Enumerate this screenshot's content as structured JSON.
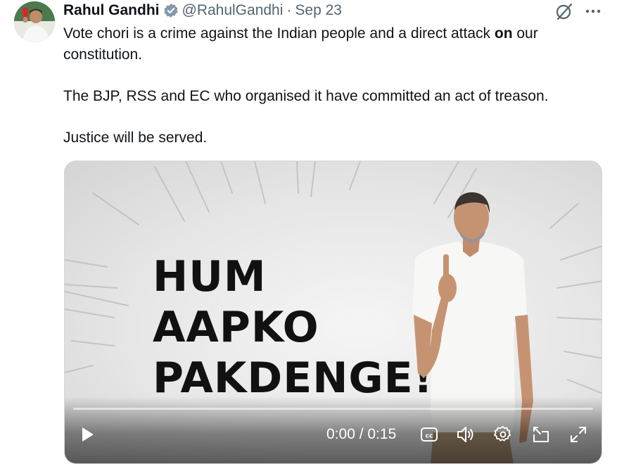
{
  "author": {
    "name": "Rahul Gandhi",
    "handle": "@RahulGandhi",
    "separator": "·",
    "date": "Sep 23",
    "verified": true
  },
  "tweet": {
    "line1_pre": "Vote chori is a crime against the Indian people and a direct attack ",
    "line1_bold": "on",
    "line1_post": " our constitution.",
    "paragraph2": "The BJP, RSS and EC who organised it have committed an act of treason.",
    "paragraph3": "Justice will be served."
  },
  "video": {
    "headline": [
      "HUM",
      "AAPKO",
      "PAKDENGE!"
    ],
    "time": "0:00 / 0:15",
    "progress": 0
  },
  "icons": {
    "verified": "verified-badge-icon",
    "grok": "grok-icon",
    "more": "more-icon",
    "play": "play-icon",
    "captions": "captions-icon",
    "volume": "volume-icon",
    "settings": "settings-icon",
    "popout": "popout-icon",
    "fullscreen": "fullscreen-icon"
  },
  "colors": {
    "text": "#0f1419",
    "secondary": "#536471",
    "verified": "#829aab"
  }
}
